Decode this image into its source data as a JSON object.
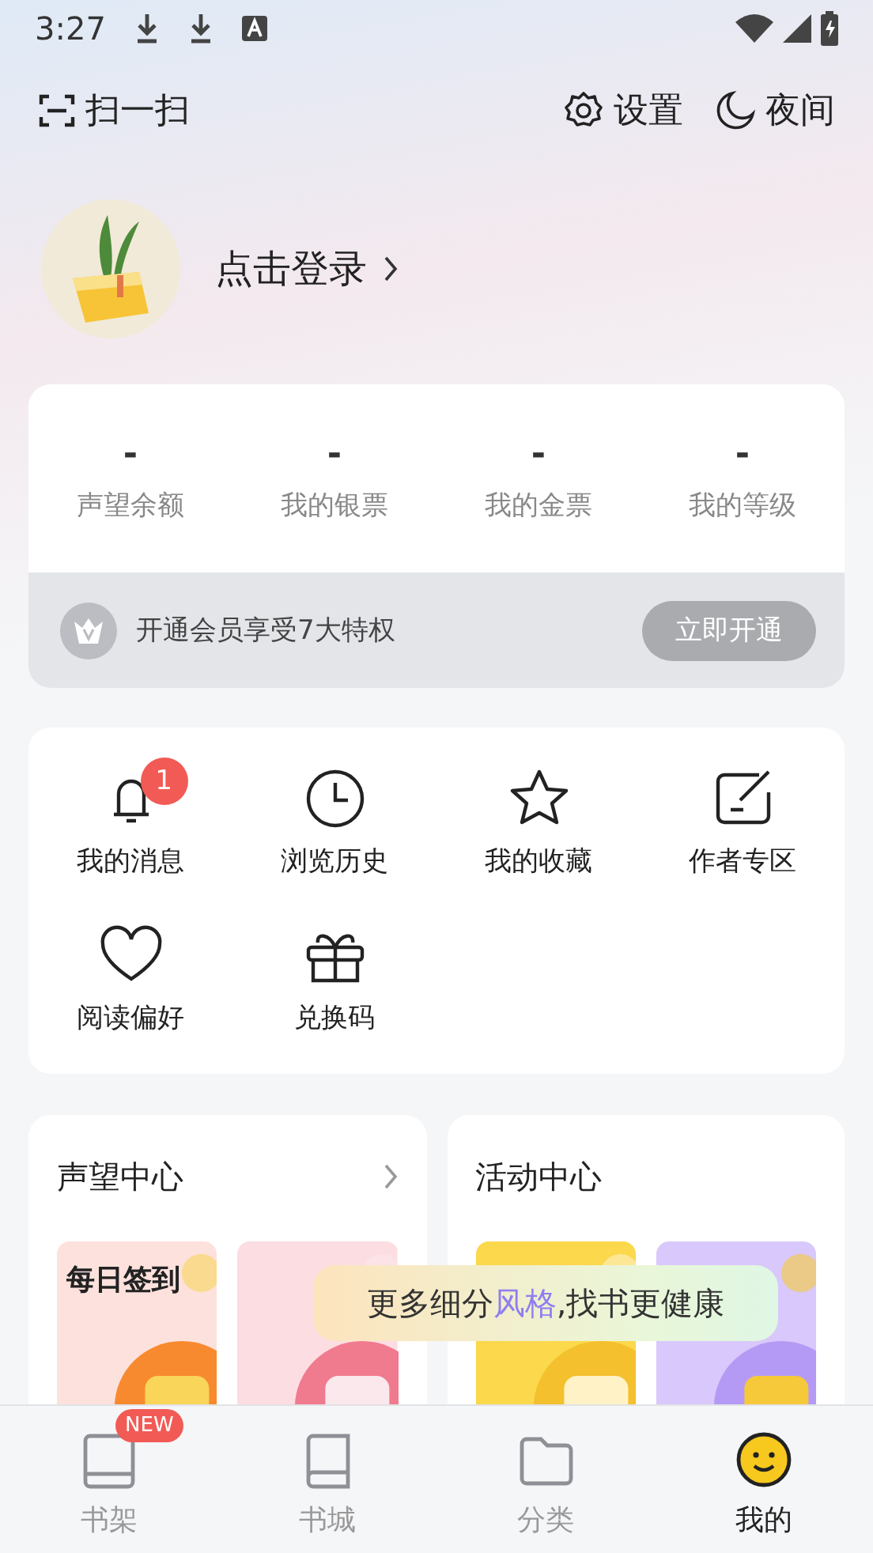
{
  "status_bar": {
    "time": "3:27"
  },
  "header": {
    "scan": "扫一扫",
    "settings": "设置",
    "night": "夜间"
  },
  "profile": {
    "login": "点击登录"
  },
  "stats": [
    {
      "value": "-",
      "label": "声望余额"
    },
    {
      "value": "-",
      "label": "我的银票"
    },
    {
      "value": "-",
      "label": "我的金票"
    },
    {
      "value": "-",
      "label": "我的等级"
    }
  ],
  "vip": {
    "text": "开通会员享受7大特权",
    "button": "立即开通"
  },
  "shortcuts": [
    {
      "kind": "bell",
      "label": "我的消息",
      "badge": "1"
    },
    {
      "kind": "clock",
      "label": "浏览历史"
    },
    {
      "kind": "star",
      "label": "我的收藏"
    },
    {
      "kind": "edit",
      "label": "作者专区"
    },
    {
      "kind": "heart",
      "label": "阅读偏好"
    },
    {
      "kind": "gift",
      "label": "兑换码"
    }
  ],
  "centers": [
    {
      "title": "声望中心",
      "more": true,
      "tiles": [
        {
          "kind": "picture",
          "title": "每日签到"
        },
        {
          "kind": "picture"
        }
      ]
    },
    {
      "title": "活动中心",
      "more": false,
      "tiles": [
        {
          "kind": "picture"
        },
        {
          "kind": "picture"
        }
      ]
    }
  ],
  "toast": {
    "before": "更多细分",
    "highlight": "风格",
    "after": ",找书更健康"
  },
  "nav": [
    {
      "kind": "shelf",
      "label": "书架",
      "badge": "NEW",
      "selected": false
    },
    {
      "kind": "book",
      "label": "书城",
      "selected": false
    },
    {
      "kind": "folder",
      "label": "分类",
      "selected": false
    },
    {
      "kind": "me",
      "label": "我的",
      "selected": true
    }
  ]
}
